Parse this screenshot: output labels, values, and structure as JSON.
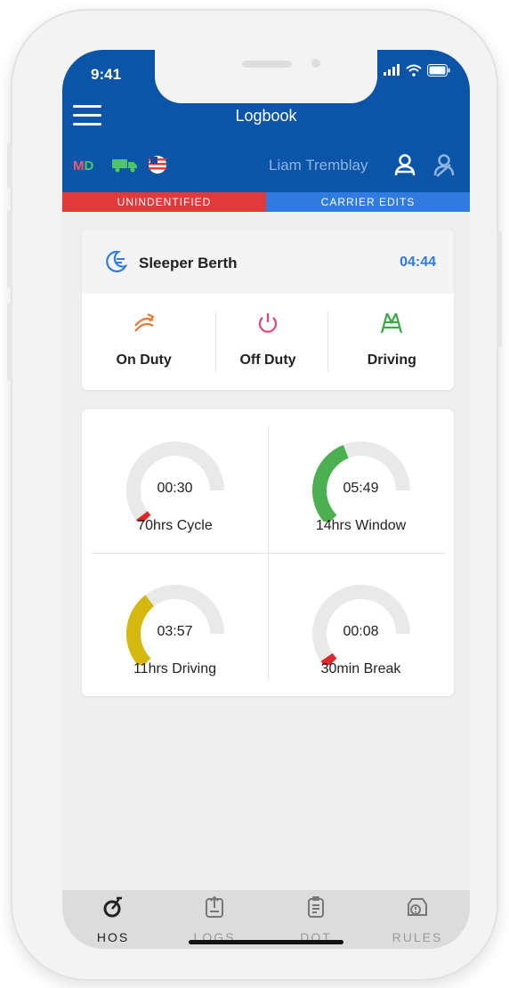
{
  "status_bar": {
    "time": "9:41"
  },
  "header": {
    "title": "Logbook",
    "state_code": {
      "m": "M",
      "d": "D"
    },
    "driver_name": "Liam Tremblay"
  },
  "tabs": [
    {
      "label": "UNINDENTIFIED",
      "color": "#e23a3a"
    },
    {
      "label": "CARRIER EDITS",
      "color": "#2f7be0"
    }
  ],
  "current_status": {
    "label": "Sleeper Berth",
    "time": "04:44",
    "icon": "sleeper-moon-icon"
  },
  "duty_options": [
    {
      "label": "On Duty",
      "icon": "on-duty-icon",
      "color": "#e07b3a"
    },
    {
      "label": "Off Duty",
      "icon": "power-icon",
      "color": "#e0457a"
    },
    {
      "label": "Driving",
      "icon": "driving-road-icon",
      "color": "#3aa845"
    }
  ],
  "gauges": [
    {
      "value": "00:30",
      "label": "70hrs Cycle",
      "fill": 0.03,
      "color": "#e02828"
    },
    {
      "value": "05:49",
      "label": "14hrs Window",
      "fill": 0.42,
      "color": "#4caf50"
    },
    {
      "value": "03:57",
      "label": "11hrs Driving",
      "fill": 0.36,
      "color": "#d4b80d"
    },
    {
      "value": "00:08",
      "label": "30min Break",
      "fill": 0.04,
      "color": "#e02828"
    }
  ],
  "bottom_nav": [
    {
      "label": "HOS",
      "icon": "stopwatch-icon",
      "active": true
    },
    {
      "label": "LOGS",
      "icon": "upload-doc-icon",
      "active": false
    },
    {
      "label": "DOT",
      "icon": "clipboard-icon",
      "active": false
    },
    {
      "label": "RULES",
      "icon": "rules-shield-icon",
      "active": false
    }
  ]
}
